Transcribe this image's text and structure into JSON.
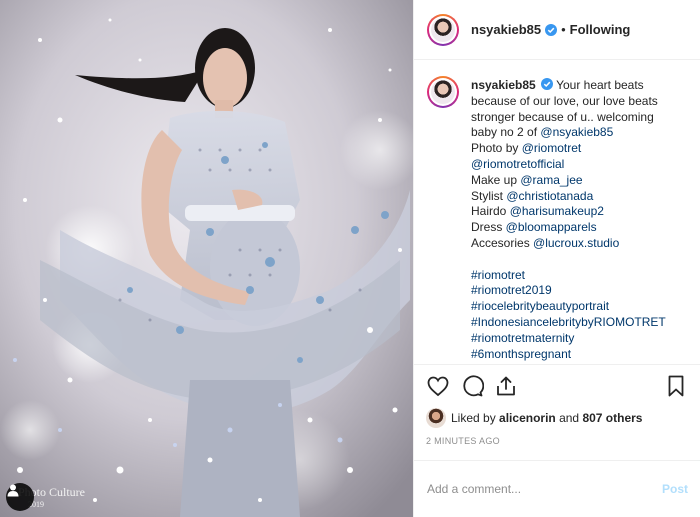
{
  "post": {
    "photo_alt": "",
    "watermark_text": "Photo Culture",
    "watermark_year": "2019"
  },
  "header": {
    "username": "nsyakieb85",
    "separator": "•",
    "follow_status": "Following"
  },
  "caption": {
    "username": "nsyakieb85",
    "lines": [
      {
        "pre": "Your heart beats",
        "link": ""
      },
      {
        "pre": "because of our love, our love beats",
        "link": ""
      },
      {
        "pre": "stronger because of u.. welcoming",
        "link": ""
      },
      {
        "pre": "baby no 2 of ",
        "link": "@nsyakieb85"
      },
      {
        "pre": "Photo by ",
        "link": "@riomotret"
      },
      {
        "pre": "",
        "link": "@riomotretofficial"
      },
      {
        "pre": "Make up ",
        "link": "@rama_jee"
      },
      {
        "pre": "Stylist ",
        "link": "@christiotanada"
      },
      {
        "pre": "Hairdo ",
        "link": "@harisumakeup2"
      },
      {
        "pre": "Dress ",
        "link": "@bloomapparels"
      },
      {
        "pre": "Accesories ",
        "link": "@lucroux.studio"
      }
    ],
    "hashtags": [
      "#riomotret",
      "#riomotret2019",
      "#riocelebritybeautyportrait",
      "#IndonesiancelebritybyRIOMOTRET",
      "#riomotretmaternity",
      "#6monthspregnant"
    ]
  },
  "actions": {
    "icons": [
      "heart-icon",
      "comment-icon",
      "share-icon",
      "bookmark-icon"
    ],
    "likes_prefix": "Liked by",
    "likes_user": "alicenorin",
    "likes_and": "and",
    "likes_count": "807 others",
    "timestamp": "2 MINUTES AGO"
  },
  "comment_box": {
    "placeholder": "Add a comment...",
    "post_label": "Post"
  },
  "colors": {
    "link": "#00376b",
    "verified": "#3897f0",
    "muted": "#8e8e8e",
    "post_disabled": "#b2dffc"
  }
}
